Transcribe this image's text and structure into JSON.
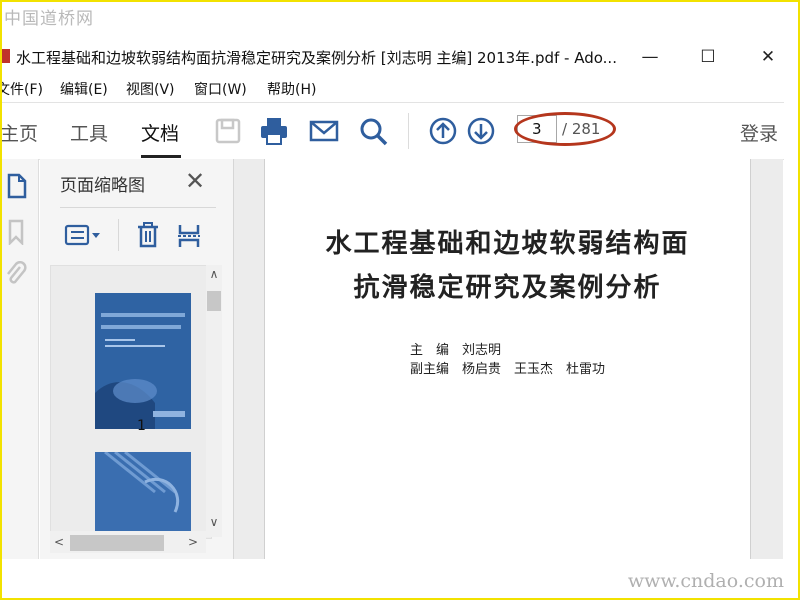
{
  "watermark": {
    "top": "中国道桥网",
    "bottom": "www.cndao.com"
  },
  "window": {
    "title": "水工程基础和边坡软弱结构面抗滑稳定研究及案例分析 [刘志明 主编] 2013年.pdf - Ado...",
    "minimize": "—",
    "maximize": "☐",
    "close": "✕"
  },
  "menu": [
    "文件(F)",
    "编辑(E)",
    "视图(V)",
    "窗口(W)",
    "帮助(H)"
  ],
  "tabs": [
    "主页",
    "工具",
    "文档"
  ],
  "toolbar": {
    "icons": [
      "save-icon",
      "print-icon",
      "email-icon",
      "search-icon",
      "page-up-icon",
      "page-down-icon"
    ],
    "page_current": "3",
    "page_total": "/ 281",
    "login": "登录"
  },
  "panel": {
    "title": "页面缩略图",
    "thumbnails": [
      {
        "label": "1"
      }
    ]
  },
  "document": {
    "title_line1": "水工程基础和边坡软弱结构面",
    "title_line2": "抗滑稳定研究及案例分析",
    "editor_line": "主　编　刘志明",
    "deputy_line": "副主编　杨启贵　王玉杰　杜雷功"
  },
  "colors": {
    "accent_annotation": "#b5361d",
    "icon_blue": "#2f5e9e",
    "cover_blue": "#2f63a3",
    "frame": "#f2e200"
  }
}
